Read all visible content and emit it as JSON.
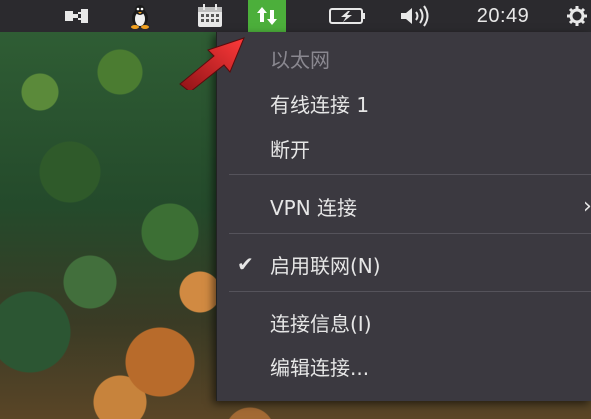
{
  "topbar": {
    "icons": [
      "plug-icon",
      "tux-icon",
      "calendar-icon",
      "network-arrows-icon",
      "battery-icon",
      "volume-icon",
      "power-icon"
    ],
    "clock": "20:49",
    "colors": {
      "bar": "#2b2a2e",
      "active_icon_bg": "#4caf3b"
    }
  },
  "menu": {
    "section_header": "以太网",
    "items": [
      {
        "label": "有线连接 1"
      },
      {
        "label": "断开"
      },
      {
        "label": "VPN 连接"
      },
      {
        "label": "启用联网(N)",
        "checked": true
      },
      {
        "label": "连接信息(I)"
      },
      {
        "label": "编辑连接..."
      }
    ],
    "colors": {
      "background": "#3b3940",
      "text": "#e6e6e6",
      "disabled_text": "#8a8890"
    }
  },
  "annotation": {
    "arrow_color": "#d8262a"
  }
}
